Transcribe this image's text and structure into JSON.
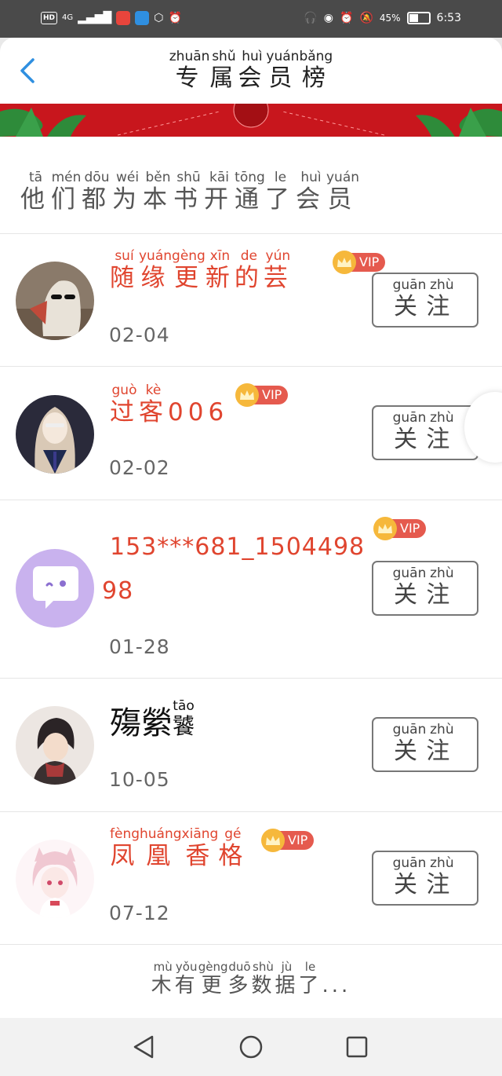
{
  "status_bar": {
    "left_badge": "HD",
    "network": "4G",
    "battery_text": "45%",
    "battery_level": 0.45,
    "time": "6:53"
  },
  "header": {
    "title": [
      {
        "char": "专",
        "pinyin": "zhuān"
      },
      {
        "char": "属",
        "pinyin": "shǔ"
      },
      {
        "char": "会",
        "pinyin": "huì"
      },
      {
        "char": "员",
        "pinyin": "yuán"
      },
      {
        "char": "榜",
        "pinyin": "bǎng"
      }
    ]
  },
  "section_title": [
    {
      "char": "他",
      "pinyin": "tā"
    },
    {
      "char": "们",
      "pinyin": "mén"
    },
    {
      "char": "都",
      "pinyin": "dōu"
    },
    {
      "char": "为",
      "pinyin": "wéi"
    },
    {
      "char": "本",
      "pinyin": "běn"
    },
    {
      "char": "书",
      "pinyin": "shū"
    },
    {
      "char": "开",
      "pinyin": "kāi"
    },
    {
      "char": "通",
      "pinyin": "tōng"
    },
    {
      "char": "了",
      "pinyin": "le"
    },
    {
      "char": "会",
      "pinyin": "huì"
    },
    {
      "char": "员",
      "pinyin": "yuán"
    }
  ],
  "vip_label": "VIP",
  "follow_button": [
    {
      "char": "关",
      "pinyin": "guān"
    },
    {
      "char": "注",
      "pinyin": "zhù"
    }
  ],
  "members": [
    {
      "name": [
        {
          "char": "随",
          "pinyin": "suí"
        },
        {
          "char": "缘",
          "pinyin": "yuán"
        },
        {
          "char": "更",
          "pinyin": "gèng"
        },
        {
          "char": "新",
          "pinyin": "xīn"
        },
        {
          "char": "的",
          "pinyin": "de"
        },
        {
          "char": "芸",
          "pinyin": "yún"
        }
      ],
      "vip": true,
      "date": "02-04",
      "avatar": "ghost-avatar-icon"
    },
    {
      "name": [
        {
          "char": "过",
          "pinyin": "guò"
        },
        {
          "char": "客",
          "pinyin": "kè"
        },
        {
          "char": "006",
          "pinyin": ""
        }
      ],
      "vip": true,
      "date": "02-02",
      "avatar": "anime-girl-avatar-icon"
    },
    {
      "name_line1": "153***681_1504498",
      "name_line2": "98",
      "vip": true,
      "date": "01-28",
      "avatar": "default-chat-avatar-icon"
    },
    {
      "name_prefix": "殤縈",
      "name_suffix": {
        "char": "饕",
        "pinyin": "tāo"
      },
      "vip": false,
      "date": "10-05",
      "avatar": "anime-boy-avatar-icon"
    },
    {
      "name": [
        {
          "char": "凤",
          "pinyin": "fèng"
        },
        {
          "char": "凰",
          "pinyin": "huáng"
        },
        {
          "char": "香",
          "pinyin": "xiāng"
        },
        {
          "char": "格",
          "pinyin": "gé"
        }
      ],
      "vip": true,
      "date": "07-12",
      "avatar": "cat-girl-avatar-icon"
    }
  ],
  "no_more": [
    {
      "char": "木",
      "pinyin": "mù"
    },
    {
      "char": "有",
      "pinyin": "yǒu"
    },
    {
      "char": "更",
      "pinyin": "gèng"
    },
    {
      "char": "多",
      "pinyin": "duō"
    },
    {
      "char": "数",
      "pinyin": "shù"
    },
    {
      "char": "据",
      "pinyin": "jù"
    },
    {
      "char": "了",
      "pinyin": "le"
    },
    {
      "char": "...",
      "pinyin": ""
    }
  ],
  "colors": {
    "accent_red": "#e0452f",
    "back_blue": "#2f8fe0",
    "banner_red": "#c8161d",
    "vip_gold": "#f6b83b"
  }
}
